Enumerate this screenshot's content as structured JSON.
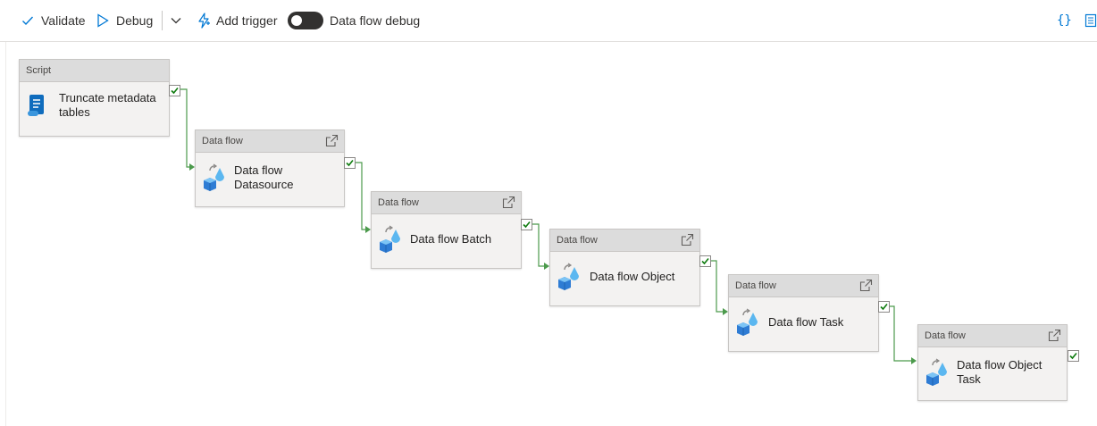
{
  "toolbar": {
    "validate_label": "Validate",
    "debug_label": "Debug",
    "add_trigger_label": "Add trigger",
    "dataflow_debug_label": "Data flow debug",
    "code_icon_text": "{}"
  },
  "colors": {
    "accent": "#0078d4",
    "success": "#107c10",
    "wire": "#4c9a4c",
    "toggle_off": "#323130"
  },
  "activities": [
    {
      "type": "Script",
      "name": "Truncate metadata tables",
      "name_lines": [
        "Truncate metadata",
        "tables"
      ],
      "icon": "script-icon"
    },
    {
      "type": "Data flow",
      "name": "Data flow Datasource",
      "name_lines": [
        "Data flow",
        "Datasource"
      ],
      "icon": "dataflow-icon"
    },
    {
      "type": "Data flow",
      "name": "Data flow Batch",
      "name_lines": [
        "Data flow Batch"
      ],
      "icon": "dataflow-icon"
    },
    {
      "type": "Data flow",
      "name": "Data flow Object",
      "name_lines": [
        "Data flow Object"
      ],
      "icon": "dataflow-icon"
    },
    {
      "type": "Data flow",
      "name": "Data flow Task",
      "name_lines": [
        "Data flow Task"
      ],
      "icon": "dataflow-icon"
    },
    {
      "type": "Data flow",
      "name": "Data flow Object Task",
      "name_lines": [
        "Data flow Object",
        "Task"
      ],
      "icon": "dataflow-icon"
    }
  ]
}
